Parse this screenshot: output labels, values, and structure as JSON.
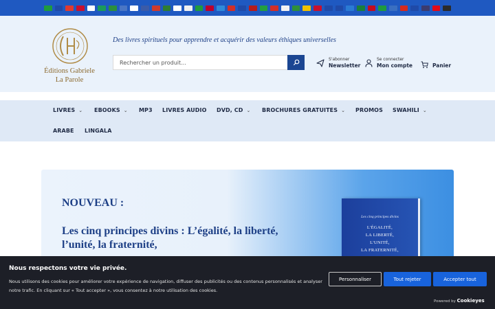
{
  "flags": [
    "#1f9b3d",
    "#1f4aa8",
    "#e03a2f",
    "#c8102e",
    "#ffffff",
    "#1b9b5a",
    "#2c8f3d",
    "#4a76c4",
    "#ffffff",
    "#3b5ba8",
    "#cf3b2d",
    "#2e7d32",
    "#ffffff",
    "#f0f0f0",
    "#1f9b3d",
    "#bc002d",
    "#2e8bd9",
    "#d22f27",
    "#1f4aa8",
    "#b71c1c",
    "#239f40",
    "#d22f27",
    "#f2f2f2",
    "#2f8f3a",
    "#f2c200",
    "#c8102e",
    "#1f4aa8",
    "#1f4aa8",
    "#2a7bd4",
    "#1b7f3a",
    "#c60b1e",
    "#1f9b3d",
    "#3a6fc1",
    "#d52b1e",
    "#1f4aa8",
    "#3c3b6e",
    "#e30a17",
    "#2b2b2b"
  ],
  "header": {
    "logo_line1": "Éditions Gabriele",
    "logo_line2": "La Parole",
    "tagline": "Des livres spirituels pour apprendre et acquérir des valeurs éthiques universelles",
    "search_placeholder": "Rechercher un produit...",
    "newsletter_small": "S'abonner",
    "newsletter_big": "Newsletter",
    "account_small": "Se connecter",
    "account_big": "Mon compte",
    "cart": "Panier"
  },
  "nav": {
    "livres": "LIVRES",
    "ebooks": "EBOOKS",
    "mp3": "MP3",
    "audio": "LIVRES AUDIO",
    "dvd": "DVD, CD",
    "brochures": "BROCHURES GRATUITES",
    "promos": "PROMOS",
    "swahili": "SWAHILI",
    "arabe": "ARABE",
    "lingala": "LINGALA"
  },
  "hero": {
    "label": "NOUVEAU :",
    "title": "Les cinq principes divins : L’égalité, la liberté, l’unité, la fraternité,",
    "book_subtitle": "Les cinq principes divins",
    "book_line1": "L'ÉGALITÉ,",
    "book_line2": "LA LIBERTÉ,",
    "book_line3": "L'UNITÉ,",
    "book_line4": "LA FRATERNITÉ,"
  },
  "cookie": {
    "title": "Nous respectons votre vie privée.",
    "text": "Nous utilisons des cookies pour améliorer votre expérience de navigation, diffuser des publicités ou des contenus personnalisés et analyser notre trafic. En cliquant sur « Tout accepter », vous consentez à notre utilisation des cookies.",
    "customize": "Personnaliser",
    "reject": "Tout rejeter",
    "accept": "Accepter tout",
    "powered_by": "Powered by",
    "brand": "Cookieyes"
  },
  "colors": {
    "topbar": "#1f59c1",
    "brand_blue": "#1b4692",
    "accept_blue": "#1863dc"
  }
}
